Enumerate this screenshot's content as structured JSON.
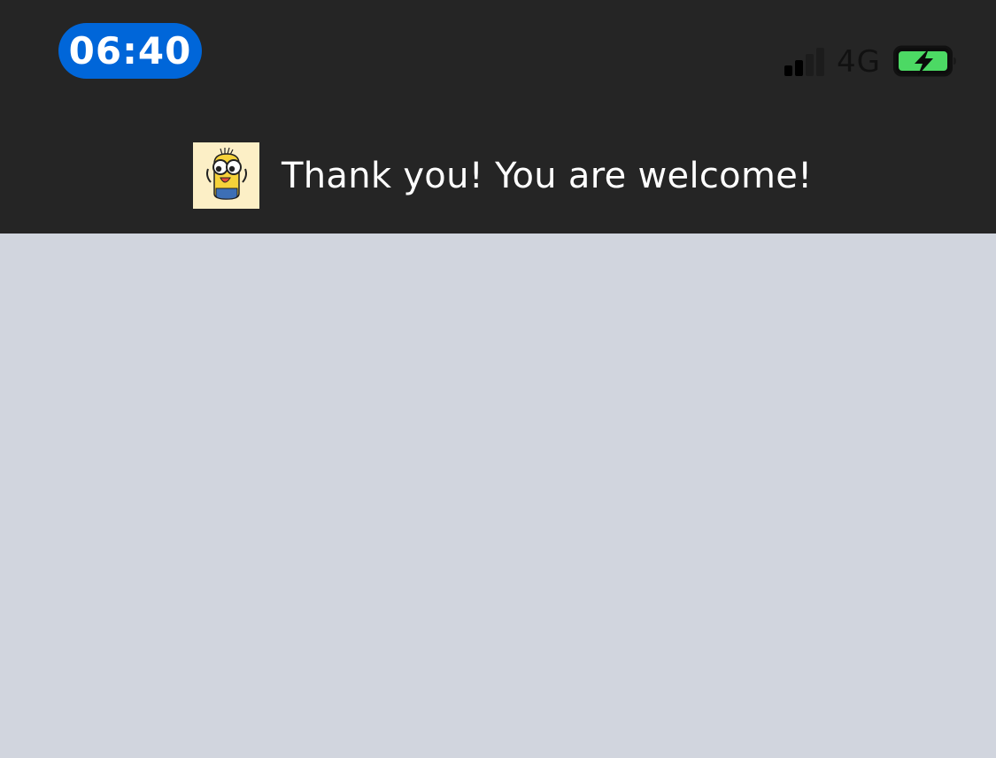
{
  "status_bar": {
    "time": "06:40",
    "network": "4G",
    "signal_bars_filled": 2,
    "signal_bars_total": 4,
    "battery_state": "charging",
    "colors": {
      "time_pill": "#0066d9",
      "battery_fill": "#4cd964",
      "background": "#252525"
    }
  },
  "notification": {
    "avatar_icon": "minion-sticker-icon",
    "message": "Thank you! You are welcome!"
  },
  "colors": {
    "content_background": "#d1d5de"
  }
}
